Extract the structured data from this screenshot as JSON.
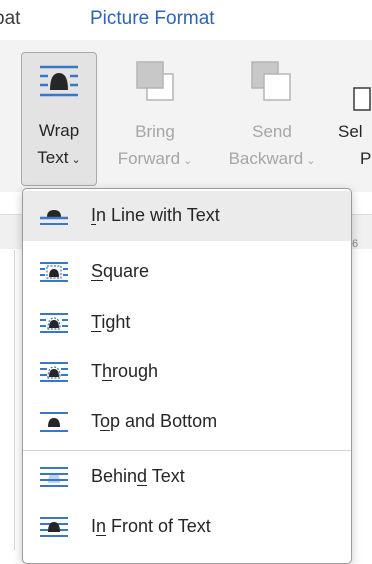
{
  "tabs": {
    "acrobat": "bat",
    "picture_format": "Picture Format"
  },
  "ribbon": {
    "wrap_text": {
      "line1": "Wrap",
      "line2": "Text",
      "caret": "⌄"
    },
    "bring_forward": {
      "line1": "Bring",
      "line2": "Forward",
      "caret": "⌄"
    },
    "send_backward": {
      "line1": "Send",
      "line2": "Backward",
      "caret": "⌄"
    },
    "selection": {
      "line1": "Sel",
      "line2": "P"
    }
  },
  "ruler": {
    "mark": "6"
  },
  "menu": {
    "items": [
      {
        "pre": "",
        "key": "I",
        "post": "n Line with Text",
        "icon": "inline-with-text-icon"
      },
      {
        "pre": "",
        "key": "S",
        "post": "quare",
        "icon": "wrap-square-icon"
      },
      {
        "pre": "",
        "key": "T",
        "post": "ight",
        "icon": "wrap-tight-icon"
      },
      {
        "pre": "T",
        "key": "h",
        "post": "rough",
        "icon": "wrap-through-icon"
      },
      {
        "pre": "T",
        "key": "o",
        "post": "p and Bottom",
        "icon": "top-and-bottom-icon"
      },
      {
        "pre": "Behin",
        "key": "d",
        "post": " Text",
        "icon": "behind-text-icon"
      },
      {
        "pre": "I",
        "key": "n",
        "post": " Front of Text",
        "icon": "in-front-of-text-icon"
      }
    ]
  },
  "colors": {
    "accent_blue": "#2f64b4",
    "icon_blue": "#3a78c6",
    "selected_bg": "#ebebeb"
  }
}
